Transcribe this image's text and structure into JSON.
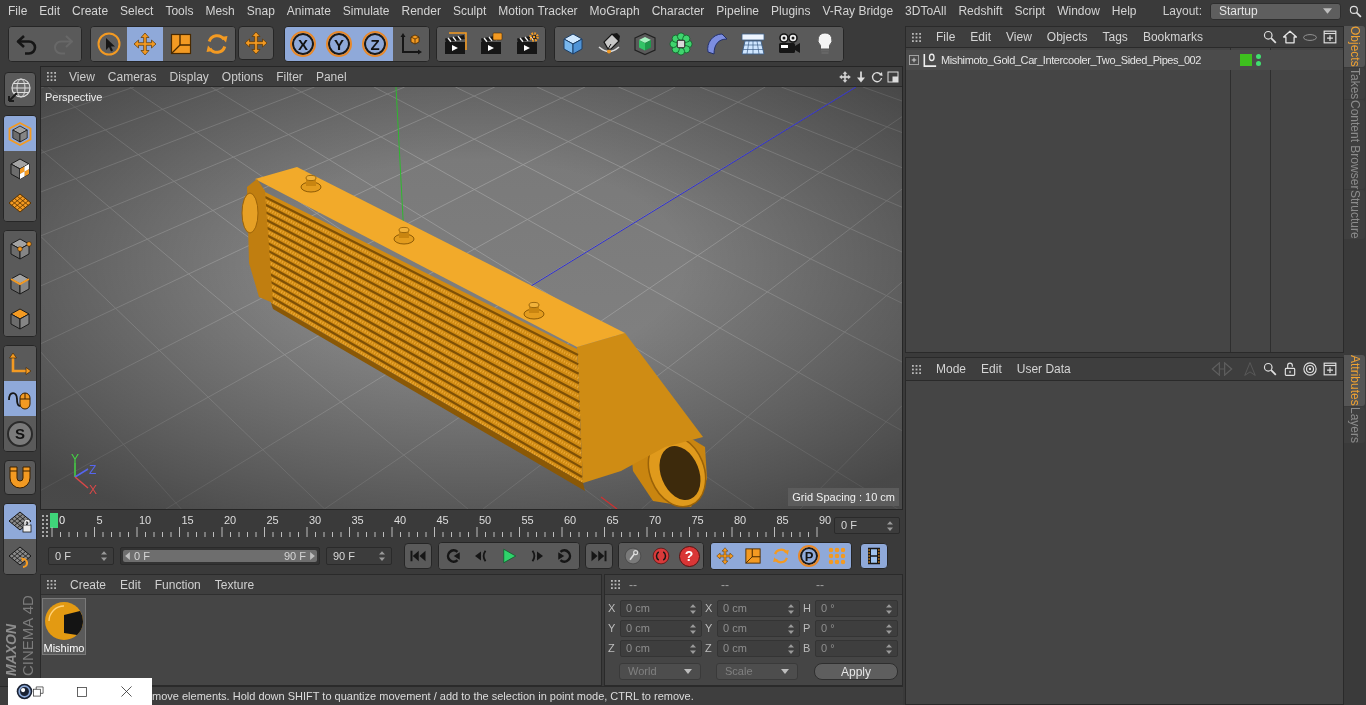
{
  "menu_bar": {
    "items": [
      "File",
      "Edit",
      "Create",
      "Select",
      "Tools",
      "Mesh",
      "Snap",
      "Animate",
      "Simulate",
      "Render",
      "Sculpt",
      "Motion Tracker",
      "MoGraph",
      "Character",
      "Pipeline",
      "Plugins",
      "V-Ray Bridge",
      "3DToAll",
      "Redshift",
      "Script",
      "Window",
      "Help"
    ],
    "layout_label": "Layout:",
    "layout_value": "Startup"
  },
  "toolbar": {
    "groups": [
      {
        "buttons": [
          {
            "kind": "undo",
            "disabled": false
          },
          {
            "kind": "redo",
            "disabled": true
          }
        ]
      },
      {
        "buttons": [
          {
            "kind": "select",
            "selected": false
          },
          {
            "kind": "move",
            "selected": true
          },
          {
            "kind": "scale",
            "selected": false
          },
          {
            "kind": "rotate",
            "selected": false
          }
        ]
      },
      {
        "buttons": [
          {
            "kind": "move",
            "selected": false
          }
        ]
      },
      {
        "buttons": [
          {
            "kind": "axis",
            "label": "X",
            "selected": true
          },
          {
            "kind": "axis",
            "label": "Y",
            "selected": true
          },
          {
            "kind": "axis",
            "label": "Z",
            "selected": true
          },
          {
            "kind": "coordinates",
            "selected": false
          }
        ]
      },
      {
        "buttons": [
          {
            "kind": "render_view"
          },
          {
            "kind": "render_picture"
          },
          {
            "kind": "render_settings"
          }
        ]
      },
      {
        "buttons": [
          {
            "kind": "cube"
          },
          {
            "kind": "pen"
          },
          {
            "kind": "subdivision"
          },
          {
            "kind": "cloner"
          },
          {
            "kind": "deformer"
          },
          {
            "kind": "floor"
          },
          {
            "kind": "camera"
          },
          {
            "kind": "light"
          }
        ]
      }
    ]
  },
  "tool_palette": {
    "groups": [
      {
        "buttons": [
          {
            "kind": "globe",
            "selected": false
          }
        ]
      },
      {
        "buttons": [
          {
            "kind": "model",
            "selected": true
          },
          {
            "kind": "texture",
            "selected": false
          },
          {
            "kind": "workplane",
            "selected": false
          }
        ]
      },
      {
        "buttons": [
          {
            "kind": "points",
            "selected": false
          },
          {
            "kind": "edges",
            "selected": false
          },
          {
            "kind": "polygons",
            "selected": false
          }
        ]
      },
      {
        "buttons": [
          {
            "kind": "axis_mode",
            "selected": false
          },
          {
            "kind": "tweak",
            "selected": true
          },
          {
            "kind": "solo",
            "label": "S",
            "selected": false
          }
        ]
      },
      {
        "buttons": [
          {
            "kind": "magnet",
            "selected": false
          }
        ]
      },
      {
        "buttons": [
          {
            "kind": "grid_lock",
            "selected": true
          },
          {
            "kind": "grid_cycle",
            "selected": false
          }
        ]
      }
    ],
    "logo": {
      "brand": "MAXON",
      "product": "CINEMA 4D"
    }
  },
  "viewport": {
    "menu": [
      "View",
      "Cameras",
      "Display",
      "Options",
      "Filter",
      "Panel"
    ],
    "camera": "Perspective",
    "grid_spacing": "Grid Spacing : 10 cm",
    "gizmo": [
      {
        "label": "Y",
        "color": "#44d444"
      },
      {
        "label": "Z",
        "color": "#5666ee"
      },
      {
        "label": "X",
        "color": "#d84848"
      }
    ]
  },
  "timeline": {
    "ruler": [
      {
        "label": "0",
        "selected": true
      },
      {
        "label": "5",
        "selected": false
      },
      {
        "label": "10",
        "selected": false
      },
      {
        "label": "15",
        "selected": false
      },
      {
        "label": "20",
        "selected": false
      },
      {
        "label": "25",
        "selected": false
      },
      {
        "label": "30",
        "selected": false
      },
      {
        "label": "35",
        "selected": false
      },
      {
        "label": "40",
        "selected": false
      },
      {
        "label": "45",
        "selected": false
      },
      {
        "label": "50",
        "selected": false
      },
      {
        "label": "55",
        "selected": false
      },
      {
        "label": "60",
        "selected": false
      },
      {
        "label": "65",
        "selected": false
      },
      {
        "label": "70",
        "selected": false
      },
      {
        "label": "75",
        "selected": false
      },
      {
        "label": "80",
        "selected": false
      },
      {
        "label": "85",
        "selected": false
      },
      {
        "label": "90",
        "selected": false
      }
    ],
    "current_frame": "0 F",
    "start": "0 F",
    "range": {
      "start": "0 F",
      "end": "90 F",
      "level": 1
    },
    "end": "90 F",
    "controls": [
      {
        "buttons": [
          {
            "kind": "first"
          }
        ]
      },
      {
        "buttons": [
          {
            "kind": "prev_key"
          },
          {
            "kind": "prev_frame"
          },
          {
            "kind": "play"
          },
          {
            "kind": "next_frame"
          },
          {
            "kind": "next_key"
          }
        ]
      },
      {
        "buttons": [
          {
            "kind": "last"
          }
        ]
      },
      {
        "buttons": [
          {
            "kind": "record_off"
          },
          {
            "kind": "autokey"
          },
          {
            "kind": "key_select",
            "label": "?"
          }
        ]
      },
      {
        "buttons": [
          {
            "kind": "move",
            "selected": true
          },
          {
            "kind": "scale",
            "selected": true
          },
          {
            "kind": "rotate",
            "selected": true
          },
          {
            "kind": "param",
            "label": "P",
            "selected": true
          },
          {
            "kind": "point_level",
            "selected": true
          }
        ]
      },
      {
        "buttons": [
          {
            "kind": "film",
            "selected": true
          }
        ]
      }
    ]
  },
  "material_manager": {
    "menu": [
      "Create",
      "Edit",
      "Function",
      "Texture"
    ],
    "materials": [
      {
        "name": "Mishimo"
      }
    ]
  },
  "coordinates": {
    "headers": [
      "--",
      "--",
      "--"
    ],
    "rows": [
      [
        {
          "axis": "X",
          "value": "0 cm"
        },
        {
          "axis": "X",
          "value": "0 cm"
        },
        {
          "axis": "H",
          "value": "0 °"
        }
      ],
      [
        {
          "axis": "Y",
          "value": "0 cm"
        },
        {
          "axis": "Y",
          "value": "0 cm"
        },
        {
          "axis": "P",
          "value": "0 °"
        }
      ],
      [
        {
          "axis": "Z",
          "value": "0 cm"
        },
        {
          "axis": "Z",
          "value": "0 cm"
        },
        {
          "axis": "B",
          "value": "0 °"
        }
      ]
    ],
    "dropdowns": [
      {
        "value": "World",
        "disabled": true
      },
      {
        "value": "Scale",
        "disabled": true
      }
    ],
    "apply": "Apply"
  },
  "status_bar": {
    "text": "move elements. Hold down SHIFT to quantize movement / add to the selection in point mode, CTRL to remove."
  },
  "minimized_window": {
    "controls": [
      {
        "kind": "app"
      },
      {
        "kind": "restore"
      },
      {
        "kind": "maximize"
      },
      {
        "kind": "close"
      }
    ]
  },
  "object_manager": {
    "menu": [
      "File",
      "Edit",
      "View",
      "Objects",
      "Tags",
      "Bookmarks"
    ],
    "objects": [
      {
        "name": "Mishimoto_Gold_Car_Intercooler_Two_Sided_Pipes_002",
        "expanded": false,
        "color": "#3ec11e",
        "editor_visible": true,
        "render_visible": true
      }
    ]
  },
  "attribute_manager": {
    "menu": [
      "Mode",
      "Edit",
      "User Data"
    ]
  },
  "side_tabs": {
    "upper": [
      {
        "label": "Objects",
        "selected": true
      },
      {
        "label": "Takes",
        "selected": false
      },
      {
        "label": "Content Browser",
        "selected": false
      },
      {
        "label": "Structure",
        "selected": false
      }
    ],
    "lower": [
      {
        "label": "Attributes",
        "selected": true
      },
      {
        "label": "Layers",
        "selected": false
      }
    ]
  }
}
